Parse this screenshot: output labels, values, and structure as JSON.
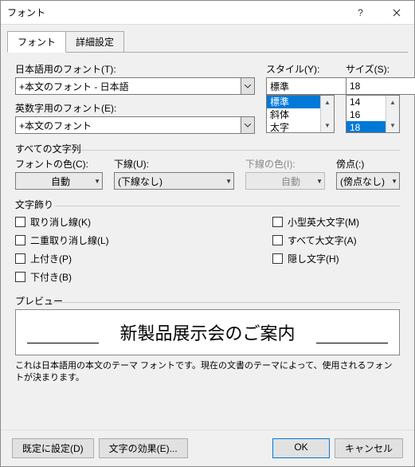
{
  "window": {
    "title": "フォント"
  },
  "tabs": {
    "font": "フォント",
    "advanced": "詳細設定"
  },
  "jpfont": {
    "label": "日本語用のフォント(T):",
    "value": "+本文のフォント - 日本語"
  },
  "enfont": {
    "label": "英数字用のフォント(E):",
    "value": "+本文のフォント"
  },
  "style": {
    "label": "スタイル(Y):",
    "value": "標準",
    "options": [
      "標準",
      "斜体",
      "太字"
    ]
  },
  "size": {
    "label": "サイズ(S):",
    "value": "18",
    "options": [
      "14",
      "16",
      "18"
    ]
  },
  "allchars": {
    "title": "すべての文字列"
  },
  "fontcolor": {
    "label": "フォントの色(C):",
    "value": "自動"
  },
  "underline": {
    "label": "下線(U):",
    "value": "(下線なし)"
  },
  "ulcolor": {
    "label": "下線の色(I):",
    "value": "自動"
  },
  "emphasis": {
    "label": "傍点(:)",
    "value": "(傍点なし)"
  },
  "deco": {
    "title": "文字飾り",
    "strike": "取り消し線(K)",
    "dstrike": "二重取り消し線(L)",
    "sup": "上付き(P)",
    "sub": "下付き(B)",
    "smallcaps": "小型英大文字(M)",
    "allcaps": "すべて大文字(A)",
    "hidden": "隠し文字(H)"
  },
  "preview": {
    "title": "プレビュー",
    "text": "新製品展示会のご案内",
    "hint": "これは日本語用の本文のテーマ フォントです。現在の文書のテーマによって、使用されるフォントが決まります。"
  },
  "footer": {
    "default": "既定に設定(D)",
    "texteffects": "文字の効果(E)...",
    "ok": "OK",
    "cancel": "キャンセル"
  }
}
